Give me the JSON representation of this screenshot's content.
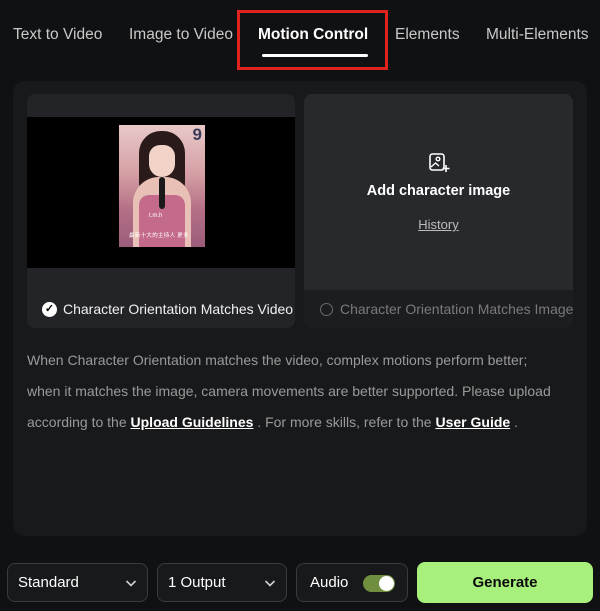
{
  "tabs": [
    {
      "label": "Text to Video"
    },
    {
      "label": "Image to Video"
    },
    {
      "label": "Motion Control",
      "active": true
    },
    {
      "label": "Elements"
    },
    {
      "label": "Multi-Elements"
    }
  ],
  "video_card": {
    "thumb_number": "9",
    "thumb_caption": "t.m.h",
    "thumb_subtitle": "最新十大的主持人 更多",
    "option_label": "Character Orientation Matches Video",
    "selected": true
  },
  "image_card": {
    "icon": "add-image-icon",
    "title": "Add character image",
    "history_link": "History",
    "option_label": "Character Orientation Matches Image",
    "selected": false
  },
  "description": {
    "line1": "When Character Orientation matches the video, complex motions perform better;",
    "line2": "when it matches the image, camera movements are better supported. Please upload",
    "line3_prefix": "according to the ",
    "upload_guidelines_link": "Upload Guidelines",
    "line3_middle": " . For more skills, refer to the ",
    "user_guide_link": "User Guide",
    "line3_suffix": " ."
  },
  "bottom_bar": {
    "quality_select": "Standard",
    "output_select": "1 Output",
    "audio_label": "Audio",
    "audio_enabled": true,
    "generate_label": "Generate"
  },
  "colors": {
    "accent_green": "#a8f07c",
    "highlight_red": "#e0231f",
    "background": "#101113"
  }
}
